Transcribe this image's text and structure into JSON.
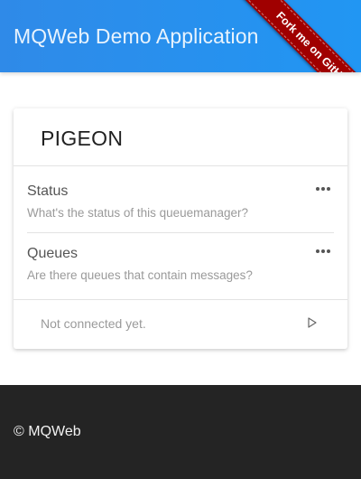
{
  "header": {
    "title": "MQWeb Demo Application",
    "ribbon_label": "Fork me on GitHub",
    "accent_color": "#2196f3",
    "ribbon_color": "#a00000"
  },
  "card": {
    "title": "PIGEON",
    "items": [
      {
        "title": "Status",
        "subtitle": "What's the status of this queuemanager?",
        "action_icon": "more-horizontal-icon"
      },
      {
        "title": "Queues",
        "subtitle": "Are there queues that contain messages?",
        "action_icon": "more-horizontal-icon"
      }
    ],
    "status_text": "Not connected yet.",
    "status_action_icon": "play-icon"
  },
  "footer": {
    "text": "© MQWeb",
    "background_color": "#242424"
  }
}
